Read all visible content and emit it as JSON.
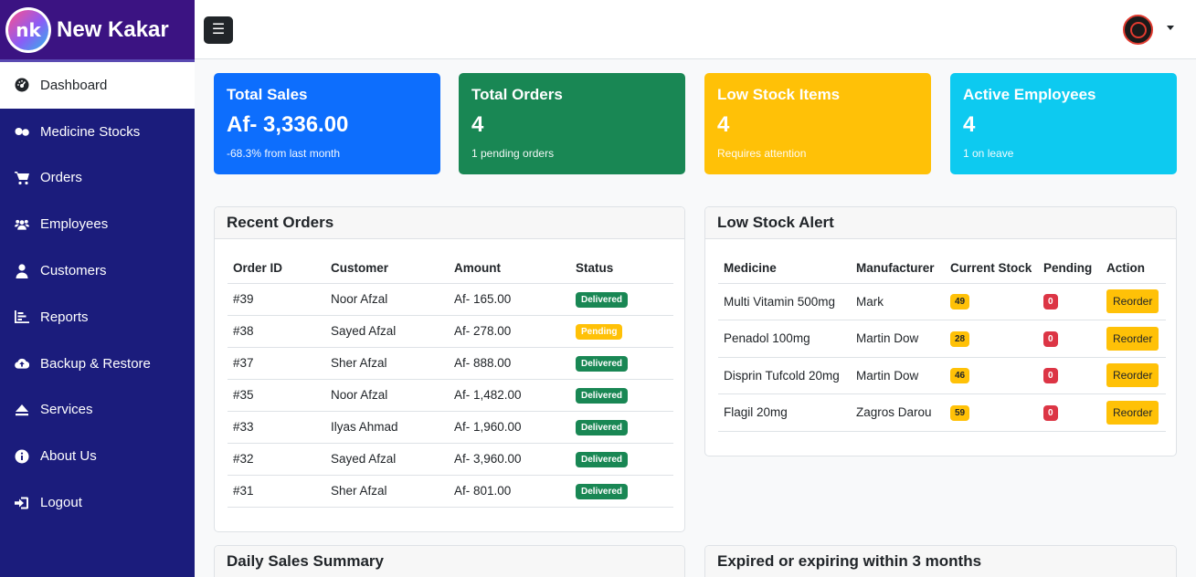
{
  "brand": {
    "logo_text": "nk",
    "name": "New Kakar"
  },
  "sidebar": {
    "items": [
      {
        "label": "Dashboard",
        "icon": "dashboard-icon"
      },
      {
        "label": "Medicine Stocks",
        "icon": "pills-icon"
      },
      {
        "label": "Orders",
        "icon": "cart-icon"
      },
      {
        "label": "Employees",
        "icon": "users-icon"
      },
      {
        "label": "Customers",
        "icon": "user-icon"
      },
      {
        "label": "Reports",
        "icon": "chart-icon"
      },
      {
        "label": "Backup & Restore",
        "icon": "cloud-upload-icon"
      },
      {
        "label": "Services",
        "icon": "eject-icon"
      },
      {
        "label": "About Us",
        "icon": "info-icon"
      },
      {
        "label": "Logout",
        "icon": "logout-icon"
      }
    ]
  },
  "topbar": {
    "menu_icon": "☰"
  },
  "stats": {
    "sales": {
      "title": "Total Sales",
      "value": "Af- 3,336.00",
      "note": "-68.3% from last month",
      "color": "#0d6efd"
    },
    "orders": {
      "title": "Total Orders",
      "value": "4",
      "note": "1 pending orders",
      "color": "#198754"
    },
    "low_stock": {
      "title": "Low Stock Items",
      "value": "4",
      "note": "Requires attention",
      "color": "#ffc107"
    },
    "employees": {
      "title": "Active Employees",
      "value": "4",
      "note": "1 on leave",
      "color": "#0dcaf0"
    }
  },
  "recent_orders": {
    "title": "Recent Orders",
    "headers": [
      "Order ID",
      "Customer",
      "Amount",
      "Status"
    ],
    "rows": [
      {
        "id": "#39",
        "customer": "Noor Afzal",
        "amount": "Af- 165.00",
        "status": "Delivered"
      },
      {
        "id": "#38",
        "customer": "Sayed Afzal",
        "amount": "Af- 278.00",
        "status": "Pending"
      },
      {
        "id": "#37",
        "customer": "Sher Afzal",
        "amount": "Af- 888.00",
        "status": "Delivered"
      },
      {
        "id": "#35",
        "customer": "Noor Afzal",
        "amount": "Af- 1,482.00",
        "status": "Delivered"
      },
      {
        "id": "#33",
        "customer": "Ilyas Ahmad",
        "amount": "Af- 1,960.00",
        "status": "Delivered"
      },
      {
        "id": "#32",
        "customer": "Sayed Afzal",
        "amount": "Af- 3,960.00",
        "status": "Delivered"
      },
      {
        "id": "#31",
        "customer": "Sher Afzal",
        "amount": "Af- 801.00",
        "status": "Delivered"
      }
    ]
  },
  "low_stock_alert": {
    "title": "Low Stock Alert",
    "headers": [
      "Medicine",
      "Manufacturer",
      "Current Stock",
      "Pending",
      "Action"
    ],
    "rows": [
      {
        "medicine": "Multi Vitamin 500mg",
        "manufacturer": "Mark",
        "stock": "49",
        "pending": "0",
        "action": "Reorder"
      },
      {
        "medicine": "Penadol 100mg",
        "manufacturer": "Martin Dow",
        "stock": "28",
        "pending": "0",
        "action": "Reorder"
      },
      {
        "medicine": "Disprin Tufcold 20mg",
        "manufacturer": "Martin Dow",
        "stock": "46",
        "pending": "0",
        "action": "Reorder"
      },
      {
        "medicine": "Flagil 20mg",
        "manufacturer": "Zagros Darou",
        "stock": "59",
        "pending": "0",
        "action": "Reorder"
      }
    ]
  },
  "daily_sales": {
    "title": "Daily Sales Summary"
  },
  "expired": {
    "title": "Expired or expiring within 3 months"
  }
}
